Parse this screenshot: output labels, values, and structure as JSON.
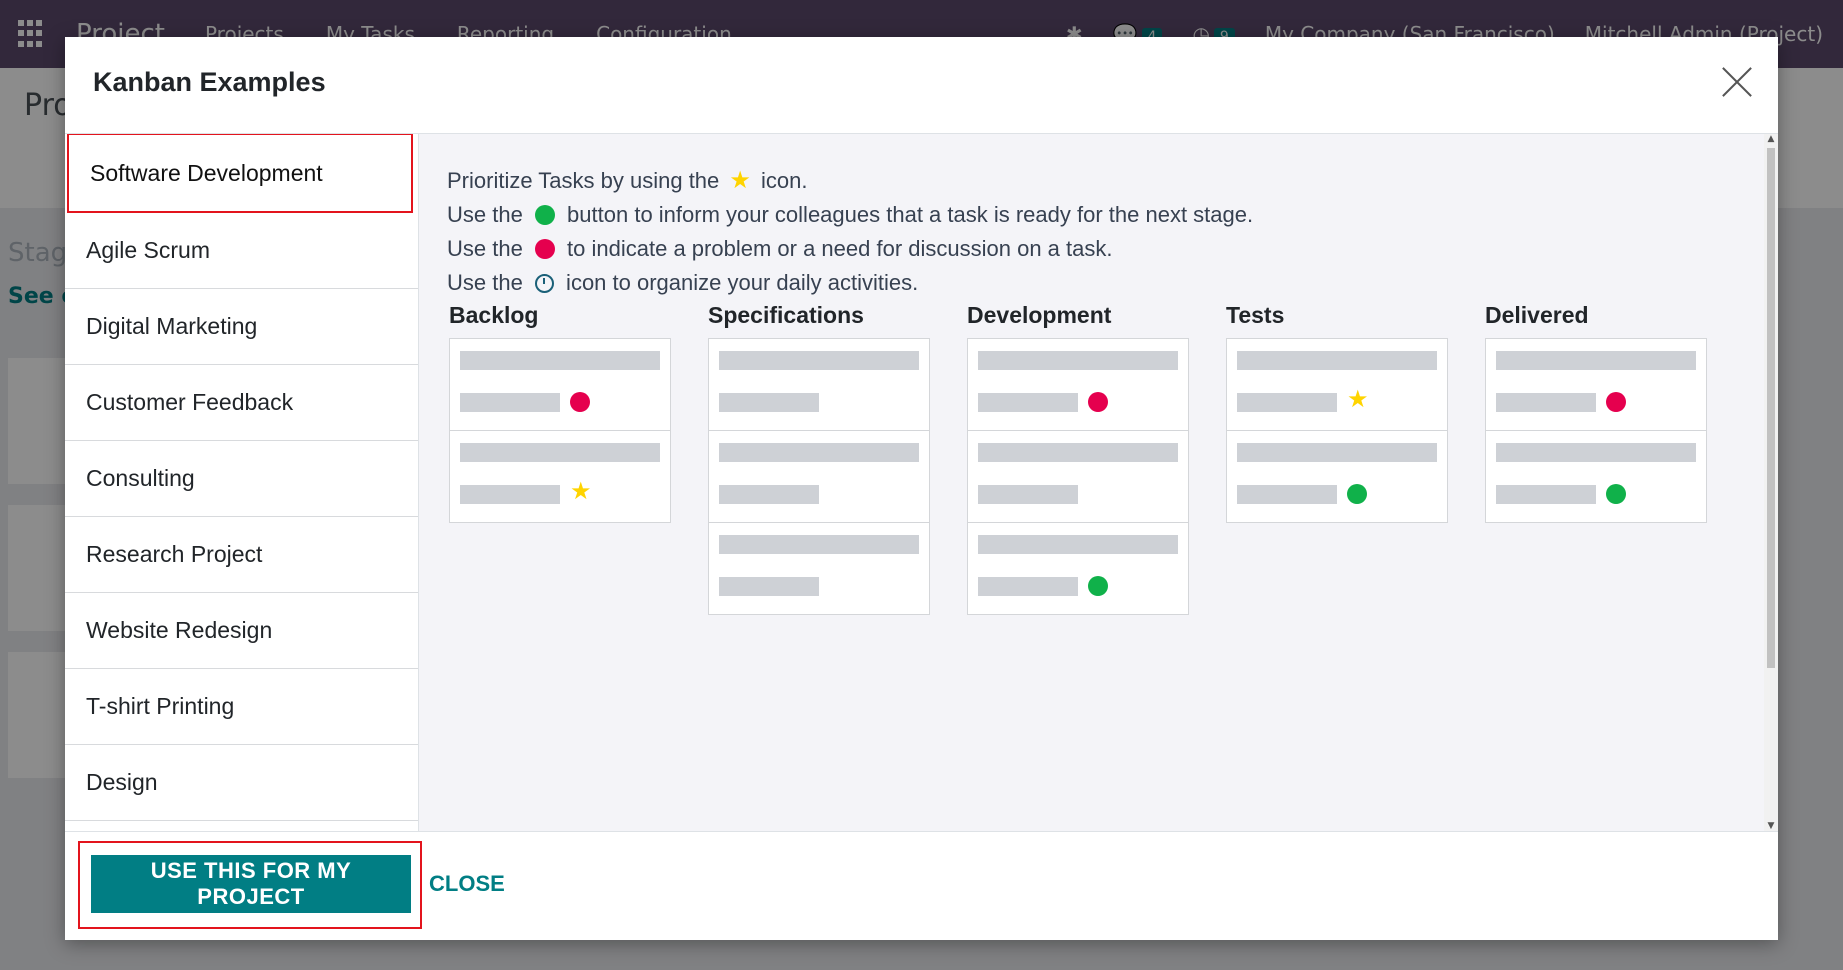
{
  "topbar": {
    "brand": "Project",
    "menus": [
      "Projects",
      "My Tasks",
      "Reporting",
      "Configuration"
    ],
    "messages_count": "4",
    "activities_count": "9",
    "company": "My Company (San Francisco)",
    "user": "Mitchell Admin (Project)"
  },
  "background": {
    "title": "Pro",
    "stage_label": "Stag",
    "see_label": "See e"
  },
  "modal": {
    "title": "Kanban Examples",
    "sidebar": {
      "items": [
        {
          "label": "Software Development"
        },
        {
          "label": "Agile Scrum"
        },
        {
          "label": "Digital Marketing"
        },
        {
          "label": "Customer Feedback"
        },
        {
          "label": "Consulting"
        },
        {
          "label": "Research Project"
        },
        {
          "label": "Website Redesign"
        },
        {
          "label": "T-shirt Printing"
        },
        {
          "label": "Design"
        }
      ],
      "active_index": 0
    },
    "help": {
      "line1_pre": "Prioritize Tasks by using the ",
      "line1_post": " icon.",
      "line2_pre": "Use the ",
      "line2_post": " button to inform your colleagues that a task is ready for the next stage.",
      "line3_pre": "Use the ",
      "line3_post": " to indicate a problem or a need for discussion on a task.",
      "line4_pre": "Use the ",
      "line4_post": " icon to organize your daily activities."
    },
    "columns": [
      {
        "title": "Backlog",
        "cards": [
          "red-dot",
          "star"
        ]
      },
      {
        "title": "Specifications",
        "cards": [
          "none",
          "none",
          "none"
        ]
      },
      {
        "title": "Development",
        "cards": [
          "red-dot",
          "none",
          "green-dot"
        ]
      },
      {
        "title": "Tests",
        "cards": [
          "star",
          "green-dot"
        ]
      },
      {
        "title": "Delivered",
        "cards": [
          "red-dot",
          "green-dot"
        ]
      }
    ],
    "footer": {
      "use_label": "USE THIS FOR MY PROJECT",
      "close_label": "CLOSE"
    },
    "colors": {
      "primary": "#017e84",
      "highlight": "#e3141d",
      "green": "#10b14a",
      "red": "#e5004e",
      "star": "#ffd400"
    }
  }
}
